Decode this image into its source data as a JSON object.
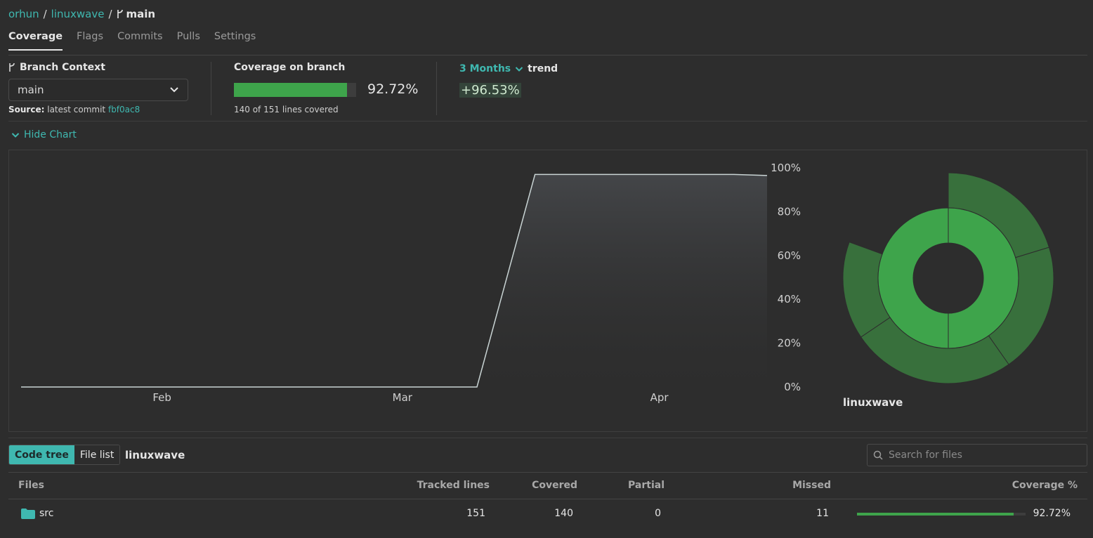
{
  "breadcrumb": {
    "owner": "orhun",
    "repo": "linuxwave",
    "branch": "main",
    "separator": "/"
  },
  "tabs": [
    "Coverage",
    "Flags",
    "Commits",
    "Pulls",
    "Settings"
  ],
  "active_tab": "Coverage",
  "branch_context": {
    "title": "Branch Context",
    "selected": "main",
    "source_label": "Source:",
    "source_text": "latest commit",
    "commit": "fbf0ac8"
  },
  "coverage": {
    "title": "Coverage on branch",
    "percent_label": "92.72%",
    "percent": 92.72,
    "lines_text": "140 of 151 lines covered"
  },
  "trend": {
    "period": "3 Months",
    "label": "trend",
    "value": "+96.53%"
  },
  "hide_chart_label": "Hide Chart",
  "chart_data": {
    "type": "area",
    "x": [
      "Jan 15",
      "Mar 10",
      "Mar 17",
      "Apr 10",
      "Apr 14"
    ],
    "y": [
      0,
      0,
      97,
      97,
      96.5
    ],
    "x_ticks": [
      "Feb",
      "Mar",
      "Apr"
    ],
    "y_ticks": [
      "0%",
      "20%",
      "40%",
      "60%",
      "80%",
      "100%"
    ],
    "ylim": [
      0,
      100
    ],
    "grid": false,
    "title": "",
    "xlabel": "",
    "ylabel": ""
  },
  "sunburst": {
    "root_label": "linuxwave",
    "inner_coverage": 92.72,
    "colors": {
      "inner": "#3ea44b",
      "outer": "#38703c"
    }
  },
  "code_view": {
    "toggle": [
      "Code tree",
      "File list"
    ],
    "active": "Code tree",
    "current_path": "linuxwave",
    "search_placeholder": "Search for files"
  },
  "table": {
    "headers": [
      "Files",
      "Tracked lines",
      "Covered",
      "Partial",
      "Missed",
      "Coverage %"
    ],
    "rows": [
      {
        "name": "src",
        "tracked": "151",
        "covered": "140",
        "partial": "0",
        "missed": "11",
        "coverage_label": "92.72%",
        "coverage": 92.72
      }
    ]
  },
  "colors": {
    "accent": "#3fb8b0",
    "coverage_green": "#3ea44b",
    "background": "#2d2d2d"
  }
}
